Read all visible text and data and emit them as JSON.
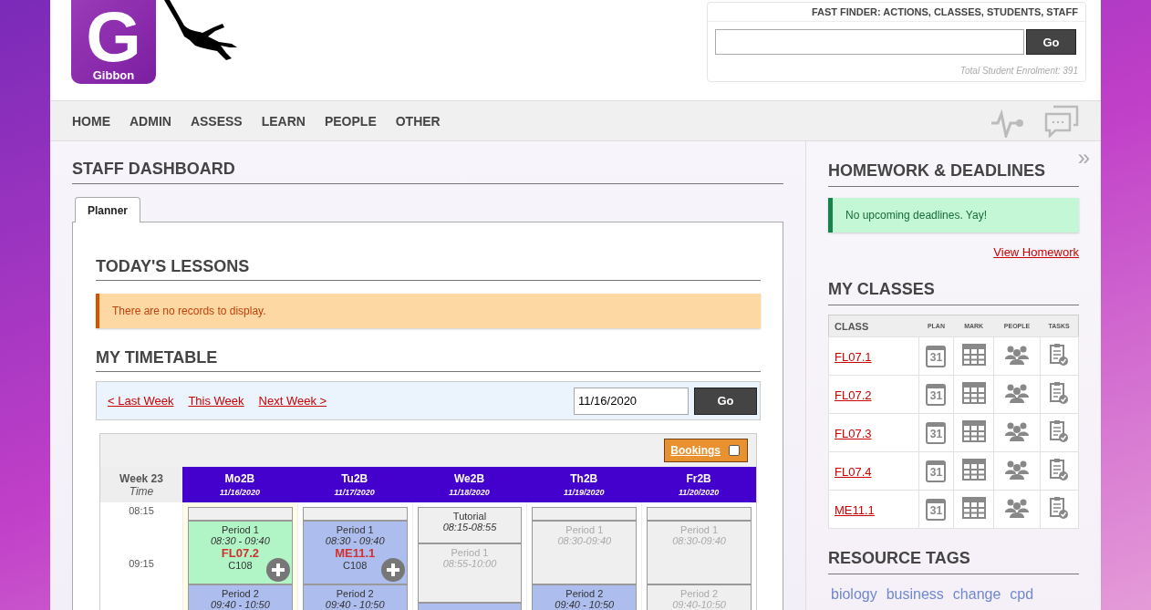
{
  "logo": {
    "letter": "G",
    "name": "Gibbon"
  },
  "fast_finder": {
    "title": "FAST FINDER: ACTIONS, CLASSES, STUDENTS, STAFF",
    "button": "Go",
    "enrolment": "Total Student Enrolment: 391"
  },
  "nav": {
    "items": [
      "HOME",
      "ADMIN",
      "ASSESS",
      "LEARN",
      "PEOPLE",
      "OTHER"
    ]
  },
  "dashboard": {
    "title": "STAFF DASHBOARD",
    "tabs": [
      {
        "label": "Planner",
        "selected": true
      }
    ],
    "todays_lessons": {
      "title": "TODAY'S LESSONS",
      "notice": "There are no records to display."
    },
    "timetable": {
      "title": "MY TIMETABLE",
      "links": [
        "< Last Week",
        "This Week",
        "Next Week >"
      ],
      "date": "11/16/2020",
      "go": "Go",
      "bookings": {
        "label": "Bookings",
        "checked": false
      },
      "week": "Week 23",
      "time_label": "Time",
      "times": [
        "08:15",
        "09:15"
      ],
      "days": [
        {
          "name": "Mo2B",
          "date": "11/16/2020",
          "today": true,
          "cells": [
            {
              "kind": "blank"
            },
            {
              "kind": "current",
              "title": "Period 1",
              "time": "08:30 - 09:40",
              "class": "FL07.2",
              "room": "C108",
              "add": true
            },
            {
              "kind": "class",
              "title": "Period 2",
              "time": "09:40 - 10:50",
              "add": false
            }
          ]
        },
        {
          "name": "Tu2B",
          "date": "11/17/2020",
          "today": false,
          "cells": [
            {
              "kind": "blank"
            },
            {
              "kind": "class",
              "title": "Period 1",
              "time": "08:30 - 09:40",
              "class": "ME11.1",
              "room": "C108",
              "add": true
            },
            {
              "kind": "class",
              "title": "Period 2",
              "time": "09:40 - 10:50",
              "add": false
            }
          ]
        },
        {
          "name": "We2B",
          "date": "11/18/2020",
          "today": false,
          "cells": [
            {
              "kind": "tutorial",
              "title": "Tutorial",
              "time": "08:15-08:55",
              "add": false
            },
            {
              "kind": "free",
              "title": "Period 1",
              "time": "08:55-10:00",
              "add": false
            },
            {
              "kind": "class"
            }
          ]
        },
        {
          "name": "Th2B",
          "date": "11/19/2020",
          "today": false,
          "cells": [
            {
              "kind": "blank"
            },
            {
              "kind": "free",
              "title": "Period 1",
              "time": "08:30-09:40",
              "add": false
            },
            {
              "kind": "class",
              "title": "Period 2",
              "time": "09:40 - 10:50",
              "add": false
            }
          ]
        },
        {
          "name": "Fr2B",
          "date": "11/20/2020",
          "today": false,
          "cells": [
            {
              "kind": "blank"
            },
            {
              "kind": "free",
              "title": "Period 1",
              "time": "08:30-09:40",
              "add": false
            },
            {
              "kind": "free",
              "title": "Period 2",
              "time": "09:40-10:50",
              "add": false
            }
          ]
        }
      ]
    }
  },
  "sidebar": {
    "homework": {
      "title": "HOMEWORK & DEADLINES",
      "notice": "No upcoming deadlines. Yay!",
      "link": "View Homework"
    },
    "classes": {
      "title": "MY CLASSES",
      "columns": [
        "CLASS",
        "PLAN",
        "MARK",
        "PEOPLE",
        "TASKS"
      ],
      "rows": [
        {
          "name": "FL07.1",
          "plan_day": "31"
        },
        {
          "name": "FL07.2",
          "plan_day": "31"
        },
        {
          "name": "FL07.3",
          "plan_day": "31"
        },
        {
          "name": "FL07.4",
          "plan_day": "31"
        },
        {
          "name": "ME11.1",
          "plan_day": "31"
        }
      ]
    },
    "tags": {
      "title": "RESOURCE TAGS",
      "items": [
        "biology",
        "business",
        "change",
        "cpd"
      ]
    },
    "collapse": "»"
  }
}
